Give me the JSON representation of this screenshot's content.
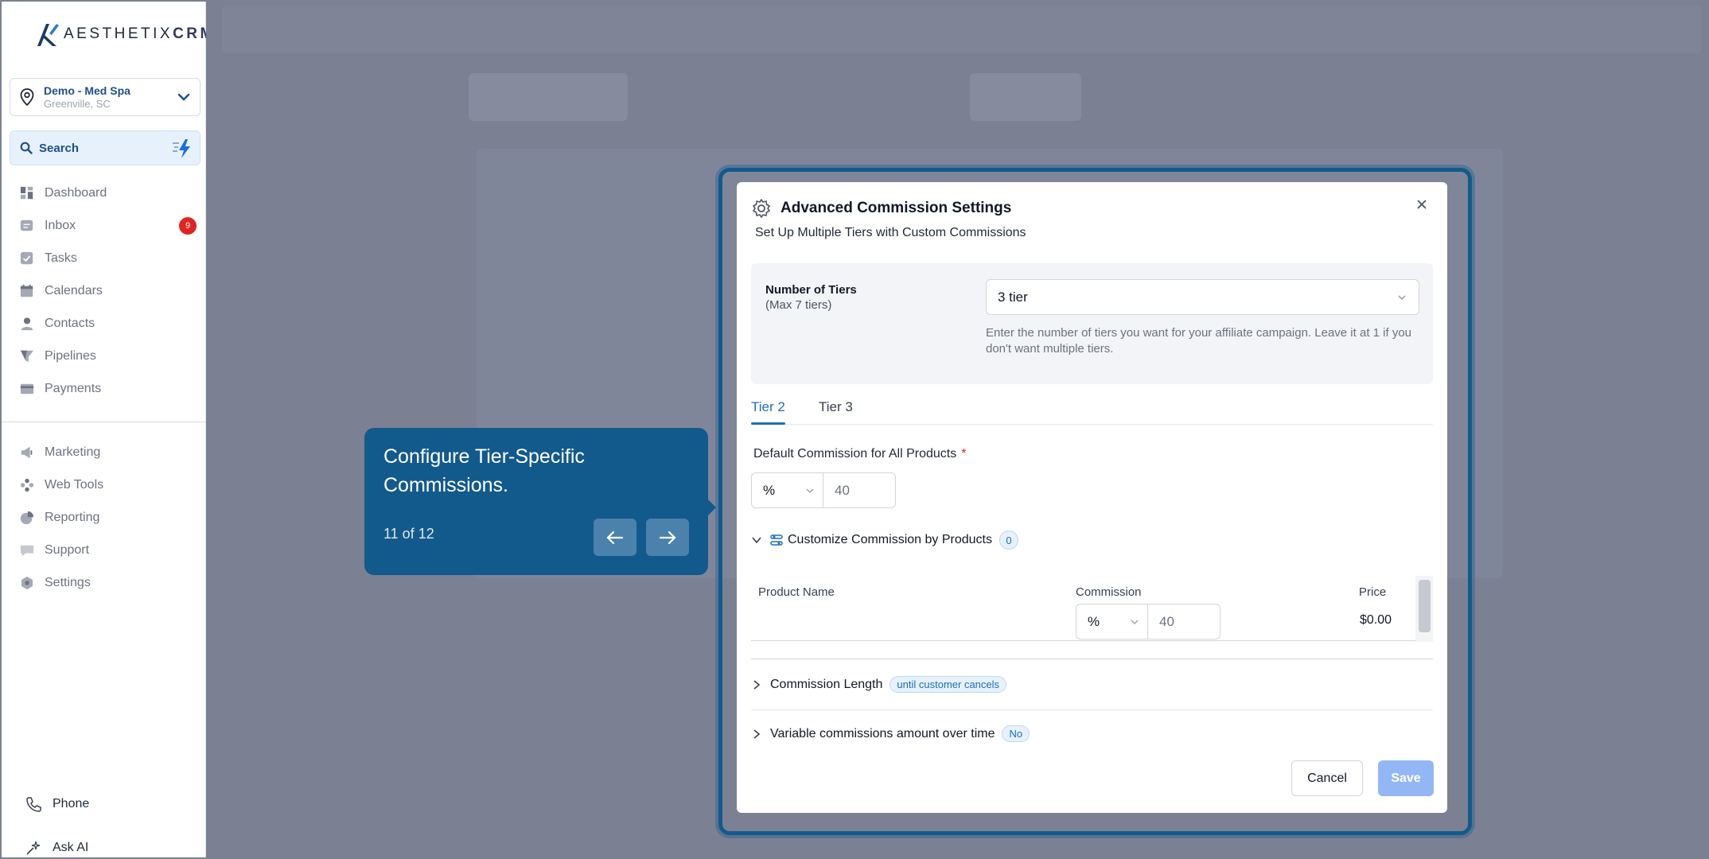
{
  "brand": {
    "name_light": "AESTHETIX",
    "name_bold": "CRM"
  },
  "location": {
    "name": "Demo - Med Spa",
    "city": "Greenville, SC"
  },
  "search": {
    "label": "Search"
  },
  "nav": {
    "primary": [
      {
        "label": "Dashboard",
        "icon": "dashboard-icon"
      },
      {
        "label": "Inbox",
        "icon": "inbox-icon",
        "badge": "9"
      },
      {
        "label": "Tasks",
        "icon": "tasks-icon"
      },
      {
        "label": "Calendars",
        "icon": "calendar-icon"
      },
      {
        "label": "Contacts",
        "icon": "contacts-icon"
      },
      {
        "label": "Pipelines",
        "icon": "funnel-icon"
      },
      {
        "label": "Payments",
        "icon": "payments-icon"
      }
    ],
    "secondary": [
      {
        "label": "Marketing",
        "icon": "megaphone-icon"
      },
      {
        "label": "Web Tools",
        "icon": "web-tools-icon"
      },
      {
        "label": "Reporting",
        "icon": "pie-chart-icon"
      },
      {
        "label": "Support",
        "icon": "chat-icon"
      },
      {
        "label": "Settings",
        "icon": "gear-icon"
      }
    ],
    "bottom": [
      {
        "label": "Phone",
        "icon": "phone-icon"
      },
      {
        "label": "Ask AI",
        "icon": "sparkle-icon"
      }
    ]
  },
  "tour": {
    "title": "Configure Tier-Specific Commissions.",
    "step": "11 of 12"
  },
  "modal": {
    "title": "Advanced Commission Settings",
    "subtitle": "Set Up Multiple Tiers with Custom Commissions",
    "tiers": {
      "label": "Number of Tiers",
      "sublabel": "(Max 7 tiers)",
      "value": "3 tier",
      "help": "Enter the number of tiers you want for your affiliate campaign. Leave it at 1 if you don't want multiple tiers."
    },
    "tabs": [
      "Tier 2",
      "Tier 3"
    ],
    "default_commission": {
      "label": "Default Commission for All Products",
      "required_mark": "*",
      "unit": "%",
      "value": "40"
    },
    "customize": {
      "label": "Customize Commission by Products",
      "count": "0"
    },
    "product_table": {
      "columns": [
        "Product Name",
        "Commission",
        "Price"
      ],
      "rows": [
        {
          "product": "",
          "unit": "%",
          "commission": "40",
          "price": "$0.00"
        }
      ]
    },
    "commission_length": {
      "label": "Commission Length",
      "value": "until customer cancels"
    },
    "variable_commissions": {
      "label": "Variable commissions amount over time",
      "value": "No"
    },
    "buttons": {
      "cancel": "Cancel",
      "save": "Save"
    }
  },
  "colors": {
    "accent": "#135a8c",
    "link": "#1e6fb8",
    "badge": "#e02424",
    "save_disabled": "#93b7f5"
  }
}
